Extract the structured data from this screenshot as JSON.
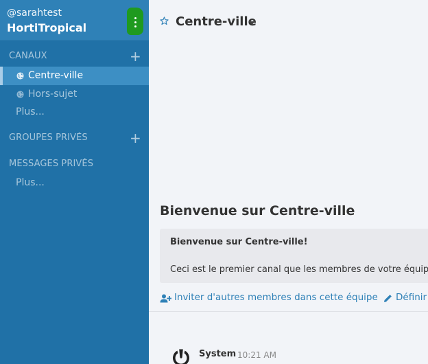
{
  "team": {
    "username": "@sarahtest",
    "name": "HortiTropical"
  },
  "sidebar": {
    "channels_title": "CANAUX",
    "channels": [
      {
        "label": "Centre-ville",
        "active": true
      },
      {
        "label": "Hors-sujet",
        "active": false
      }
    ],
    "channels_more": "Plus...",
    "private_groups_title": "GROUPES PRIVÉS",
    "private_messages_title": "MESSAGES PRIVÉS",
    "messages_more": "Plus..."
  },
  "main": {
    "channel_title": "Centre-ville",
    "intro_title": "Bienvenue sur Centre-ville",
    "intro_box_title": "Bienvenue sur Centre-ville!",
    "intro_box_text": "Ceci est le premier canal que les membres de votre équipe",
    "invite_link": "Inviter d'autres membres dans cette équipe",
    "define_link": "Définir",
    "post": {
      "author": "System",
      "time": "10:21 AM"
    }
  },
  "colors": {
    "sidebar_bg": "#2071a7",
    "team_header_bg": "#2f81b7",
    "active_channel_bg": "#3d8fc4",
    "menu_button": "#1f9a1f",
    "link": "#2f81b7",
    "main_bg": "#f2f4f8"
  },
  "icons": {
    "menu": "vertical-dots-icon",
    "add": "plus-icon",
    "channel": "globe-icon",
    "favorite": "star-outline-icon",
    "dropdown": "chevron-down-icon",
    "invite": "add-user-icon",
    "define": "pencil-icon",
    "avatar": "mattermost-logo-icon"
  }
}
